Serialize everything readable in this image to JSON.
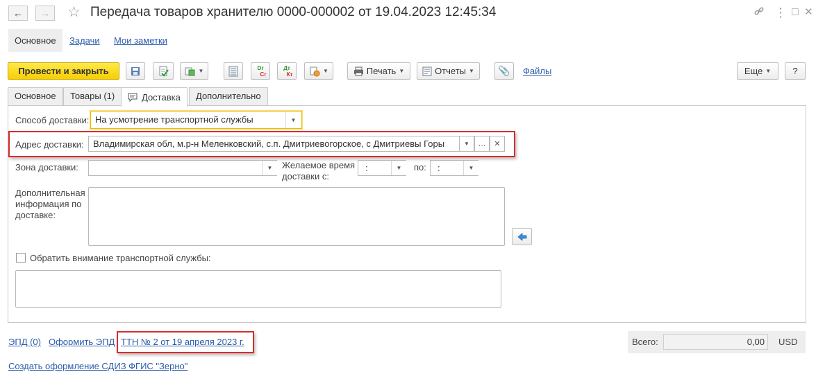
{
  "window": {
    "title": "Передача товаров хранителю 0000-000002 от 19.04.2023 12:45:34"
  },
  "section_tabs": {
    "main": "Основное",
    "tasks": "Задачи",
    "notes": "Мои заметки"
  },
  "toolbar": {
    "post_close": "Провести и закрыть",
    "print": "Печать",
    "reports": "Отчеты",
    "files": "Файлы",
    "more": "Еще",
    "help": "?",
    "dtkt_dr": "Dr",
    "dtkt_cr": "Cr",
    "dtkt_dt": "Дт",
    "dtkt_kt": "Кт"
  },
  "form_tabs": [
    "Основное",
    "Товары (1)",
    "Доставка",
    "Дополнительно"
  ],
  "delivery": {
    "method_label": "Способ доставки:",
    "method_value": "На усмотрение транспортной службы",
    "address_label": "Адрес доставки:",
    "address_value": "Владимирская обл, м.р-н Меленковский, с.п. Дмитриевогорское, с Дмитриевы Горы",
    "zone_label": "Зона доставки:",
    "zone_value": "",
    "time_label": "Желаемое время доставки с:",
    "time_from": ":",
    "time_to_label": "по:",
    "time_to": ":",
    "extra_info_label": "Дополнительная информация по доставке:",
    "attention_label": "Обратить внимание транспортной службы:",
    "attention_checked": false
  },
  "footer": {
    "epd_link": "ЭПД (0)",
    "make_epd_link": "Оформить ЭПД",
    "ttn_link": "ТТН № 2 от 19 апреля 2023 г.",
    "sdiz_link": "Создать оформление СДИЗ ФГИС \"Зерно\"",
    "total_label": "Всего:",
    "total_value": "0,00",
    "currency": "USD"
  },
  "colors": {
    "primary_button": "#f6cf00",
    "link": "#2a5caa",
    "highlight_box": "#d92b2b",
    "focus_border": "#f5b800"
  }
}
